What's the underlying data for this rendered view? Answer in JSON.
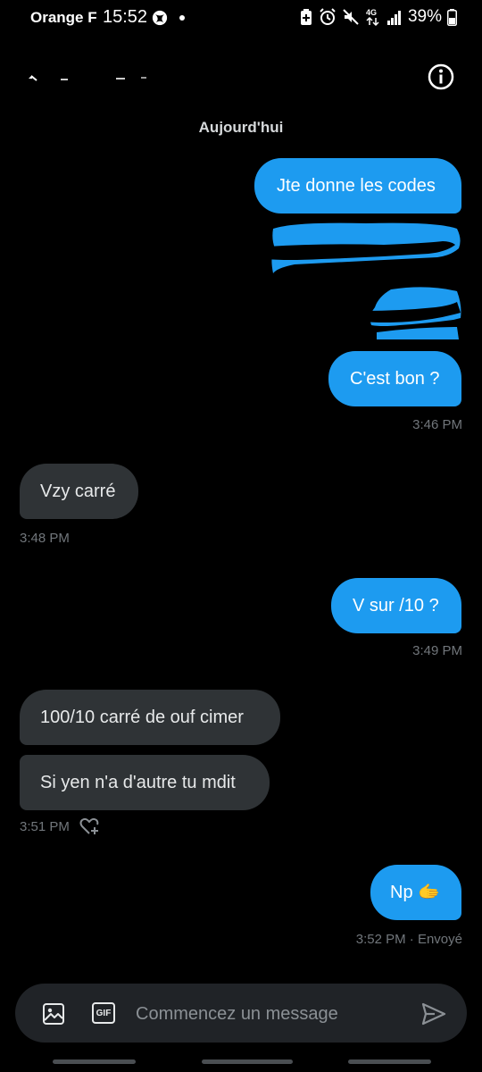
{
  "status_bar": {
    "carrier": "Orange F",
    "time": "15:52",
    "network": "4G",
    "battery": "39%"
  },
  "header": {
    "contact_name": "",
    "icons": [
      "back-arrow-icon",
      "info-icon"
    ]
  },
  "conversation": {
    "date_divider": "Aujourd'hui",
    "messages": [
      {
        "from": "me",
        "text": "Jte donne les codes"
      },
      {
        "from": "me",
        "text": ""
      },
      {
        "from": "me",
        "text": ""
      },
      {
        "from": "me",
        "text": "C'est bon ?"
      },
      {
        "from": "them",
        "text": "Vzy carré"
      },
      {
        "from": "me",
        "text": "V sur /10 ?"
      },
      {
        "from": "them",
        "text": "100/10 carré de ouf cimer"
      },
      {
        "from": "them",
        "text": "Si yen n'a d'autre tu mdit"
      },
      {
        "from": "me",
        "text": "Np 🫱"
      }
    ],
    "timestamps": {
      "t1": "3:46 PM",
      "t2": "3:48 PM",
      "t3": "3:49 PM",
      "t4": "3:51 PM",
      "t5": "3:52 PM · Envoyé"
    }
  },
  "composer": {
    "placeholder": "Commencez un message",
    "gif_label": "GIF",
    "icons": [
      "image-icon",
      "gif-icon",
      "send-icon"
    ]
  },
  "colors": {
    "background": "#000000",
    "sent_bubble": "#1d9bf0",
    "received_bubble": "#2f3336",
    "timestamp": "#71767b"
  }
}
